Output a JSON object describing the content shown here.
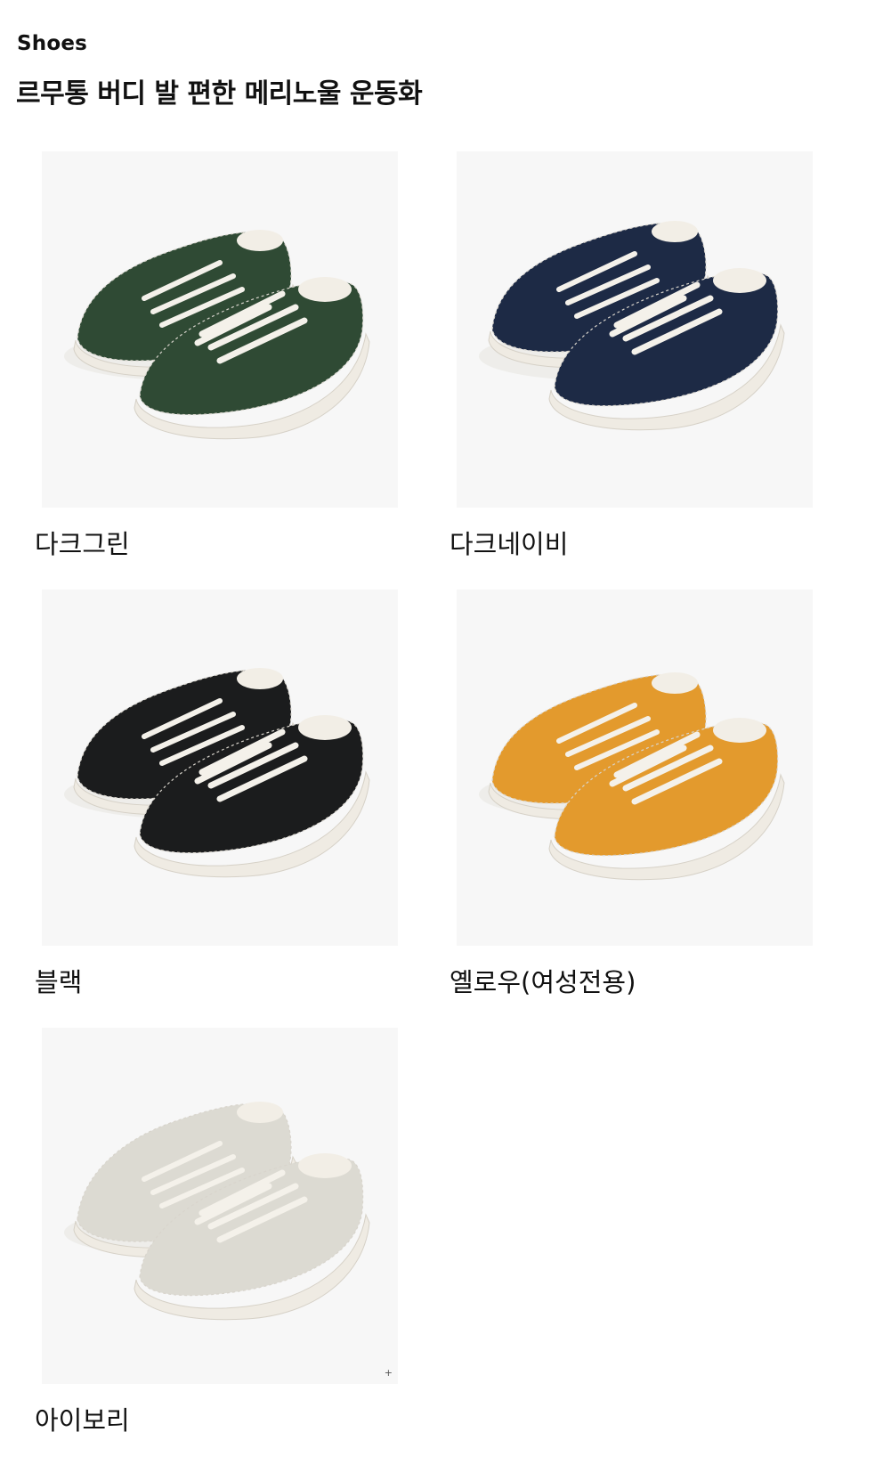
{
  "header": {
    "category": "Shoes",
    "title": "르무통 버디 발 편한 메리노울 운동화"
  },
  "products": [
    {
      "label": "다크그린",
      "image_alt": "dark green merino wool sneakers pair",
      "color": "#2f4a34"
    },
    {
      "label": "다크네이비",
      "image_alt": "dark navy merino wool sneakers pair",
      "color": "#1d2a45"
    },
    {
      "label": "블랙",
      "image_alt": "black merino wool sneakers pair",
      "color": "#1b1c1d"
    },
    {
      "label": "옐로우(여성전용)",
      "image_alt": "yellow merino wool sneakers pair",
      "color": "#e39a2d"
    },
    {
      "label": "아이보리",
      "image_alt": "ivory merino wool sneakers pair",
      "color": "#dcdad2"
    }
  ],
  "extras": {
    "corner_mark": "+"
  },
  "colors": {
    "background": "#ffffff",
    "photo_background": "#f7f7f7",
    "sole": "#efebe3",
    "laces": "#f4f1ea",
    "text": "#111111"
  },
  "icons": {
    "corner_mark": "plus-icon"
  }
}
